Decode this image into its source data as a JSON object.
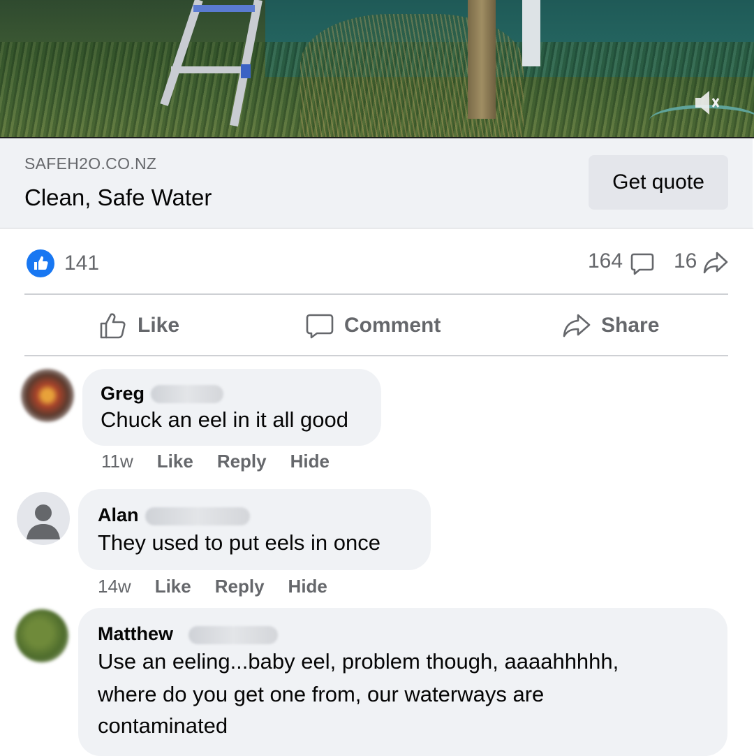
{
  "link_card": {
    "domain": "SAFEH2O.CO.NZ",
    "headline": "Clean, Safe Water",
    "cta_label": "Get quote"
  },
  "stats": {
    "likes": "141",
    "comments": "164",
    "shares": "16"
  },
  "actions": {
    "like": "Like",
    "comment": "Comment",
    "share": "Share"
  },
  "comments": [
    {
      "author": "Greg",
      "text": "Chuck an eel in it all good",
      "time": "11w",
      "like": "Like",
      "reply": "Reply",
      "hide": "Hide"
    },
    {
      "author": "Alan",
      "text": "They used to put eels in once",
      "time": "14w",
      "like": "Like",
      "reply": "Reply",
      "hide": "Hide"
    },
    {
      "author": "Matthew",
      "text_lines": [
        "Use an eeling...baby eel, problem though, aaaahhhhh,",
        "where do you get one from, our waterways are",
        "contaminated"
      ]
    }
  ],
  "colors": {
    "brand_blue": "#1877f2",
    "secondary_text": "#65676b",
    "bubble_bg": "#f0f2f5"
  },
  "icons": [
    "mute-icon",
    "like-badge-icon",
    "comment-icon",
    "share-icon",
    "thumbs-up-icon",
    "default-avatar-icon"
  ]
}
